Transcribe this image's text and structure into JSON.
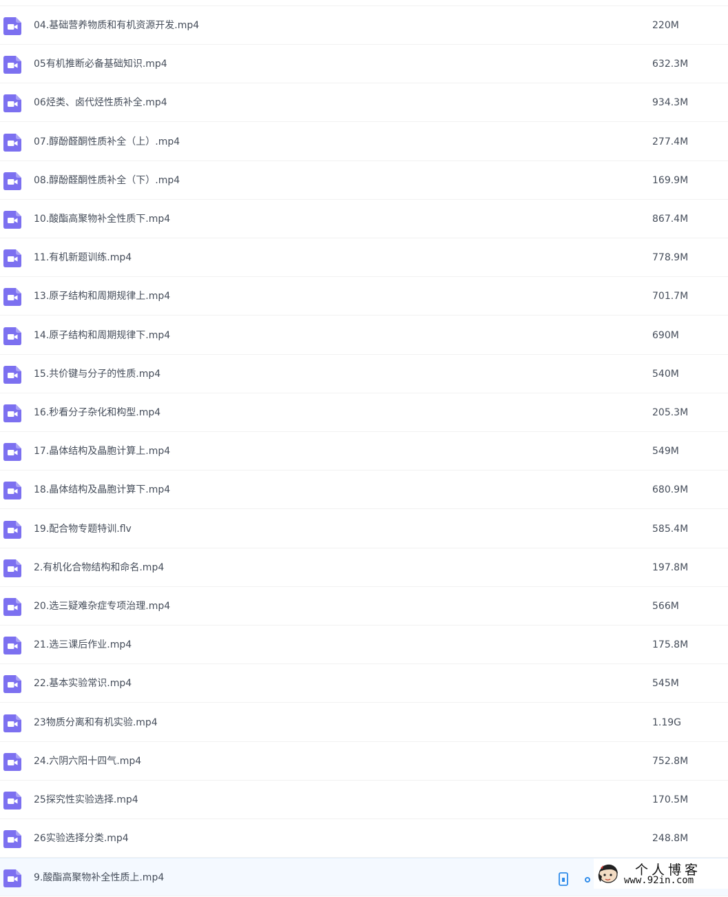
{
  "files": [
    {
      "name": "04.基础营养物质和有机资源开发.mp4",
      "size": "220M",
      "icon": "video-file-icon"
    },
    {
      "name": "05有机推断必备基础知识.mp4",
      "size": "632.3M",
      "icon": "video-file-icon"
    },
    {
      "name": "06烃类、卤代烃性质补全.mp4",
      "size": "934.3M",
      "icon": "video-file-icon"
    },
    {
      "name": "07.醇酚醛酮性质补全（上）.mp4",
      "size": "277.4M",
      "icon": "video-file-icon"
    },
    {
      "name": "08.醇酚醛酮性质补全（下）.mp4",
      "size": "169.9M",
      "icon": "video-file-icon"
    },
    {
      "name": "10.酸酯高聚物补全性质下.mp4",
      "size": "867.4M",
      "icon": "video-file-icon"
    },
    {
      "name": "11.有机新题训练.mp4",
      "size": "778.9M",
      "icon": "video-file-icon"
    },
    {
      "name": "13.原子结构和周期规律上.mp4",
      "size": "701.7M",
      "icon": "video-file-icon"
    },
    {
      "name": "14.原子结构和周期规律下.mp4",
      "size": "690M",
      "icon": "video-file-icon"
    },
    {
      "name": "15.共价键与分子的性质.mp4",
      "size": "540M",
      "icon": "video-file-icon"
    },
    {
      "name": "16.秒看分子杂化和构型.mp4",
      "size": "205.3M",
      "icon": "video-file-icon"
    },
    {
      "name": "17.晶体结构及晶胞计算上.mp4",
      "size": "549M",
      "icon": "video-file-icon"
    },
    {
      "name": "18.晶体结构及晶胞计算下.mp4",
      "size": "680.9M",
      "icon": "video-file-icon"
    },
    {
      "name": "19.配合物专题特训.flv",
      "size": "585.4M",
      "icon": "video-file-icon"
    },
    {
      "name": "2.有机化合物结构和命名.mp4",
      "size": "197.8M",
      "icon": "video-file-icon"
    },
    {
      "name": "20.选三疑难杂症专项治理.mp4",
      "size": "566M",
      "icon": "video-file-icon"
    },
    {
      "name": "21.选三课后作业.mp4",
      "size": "175.8M",
      "icon": "video-file-icon"
    },
    {
      "name": "22.基本实验常识.mp4",
      "size": "545M",
      "icon": "video-file-icon"
    },
    {
      "name": "23物质分离和有机实验.mp4",
      "size": "1.19G",
      "icon": "video-file-icon"
    },
    {
      "name": "24.六阴六阳十四气.mp4",
      "size": "752.8M",
      "icon": "video-file-icon"
    },
    {
      "name": "25探究性实验选择.mp4",
      "size": "170.5M",
      "icon": "video-file-icon"
    },
    {
      "name": "26实验选择分类.mp4",
      "size": "248.8M",
      "icon": "video-file-icon"
    },
    {
      "name": "9.酸酯高聚物补全性质上.mp4",
      "size": "",
      "icon": "video-file-icon",
      "hovered": true
    }
  ],
  "row_actions": {
    "phone_icon": "phone-icon",
    "share_icon": "share-icon"
  },
  "watermark": {
    "line1": "个人博客",
    "line2": "www.92in.com"
  },
  "colors": {
    "icon_purple": "#7c70f0",
    "text": "#454d5a",
    "hover_bg": "#f4f9ff",
    "divider": "#f1f1f1",
    "action_blue": "#2f8cea"
  }
}
